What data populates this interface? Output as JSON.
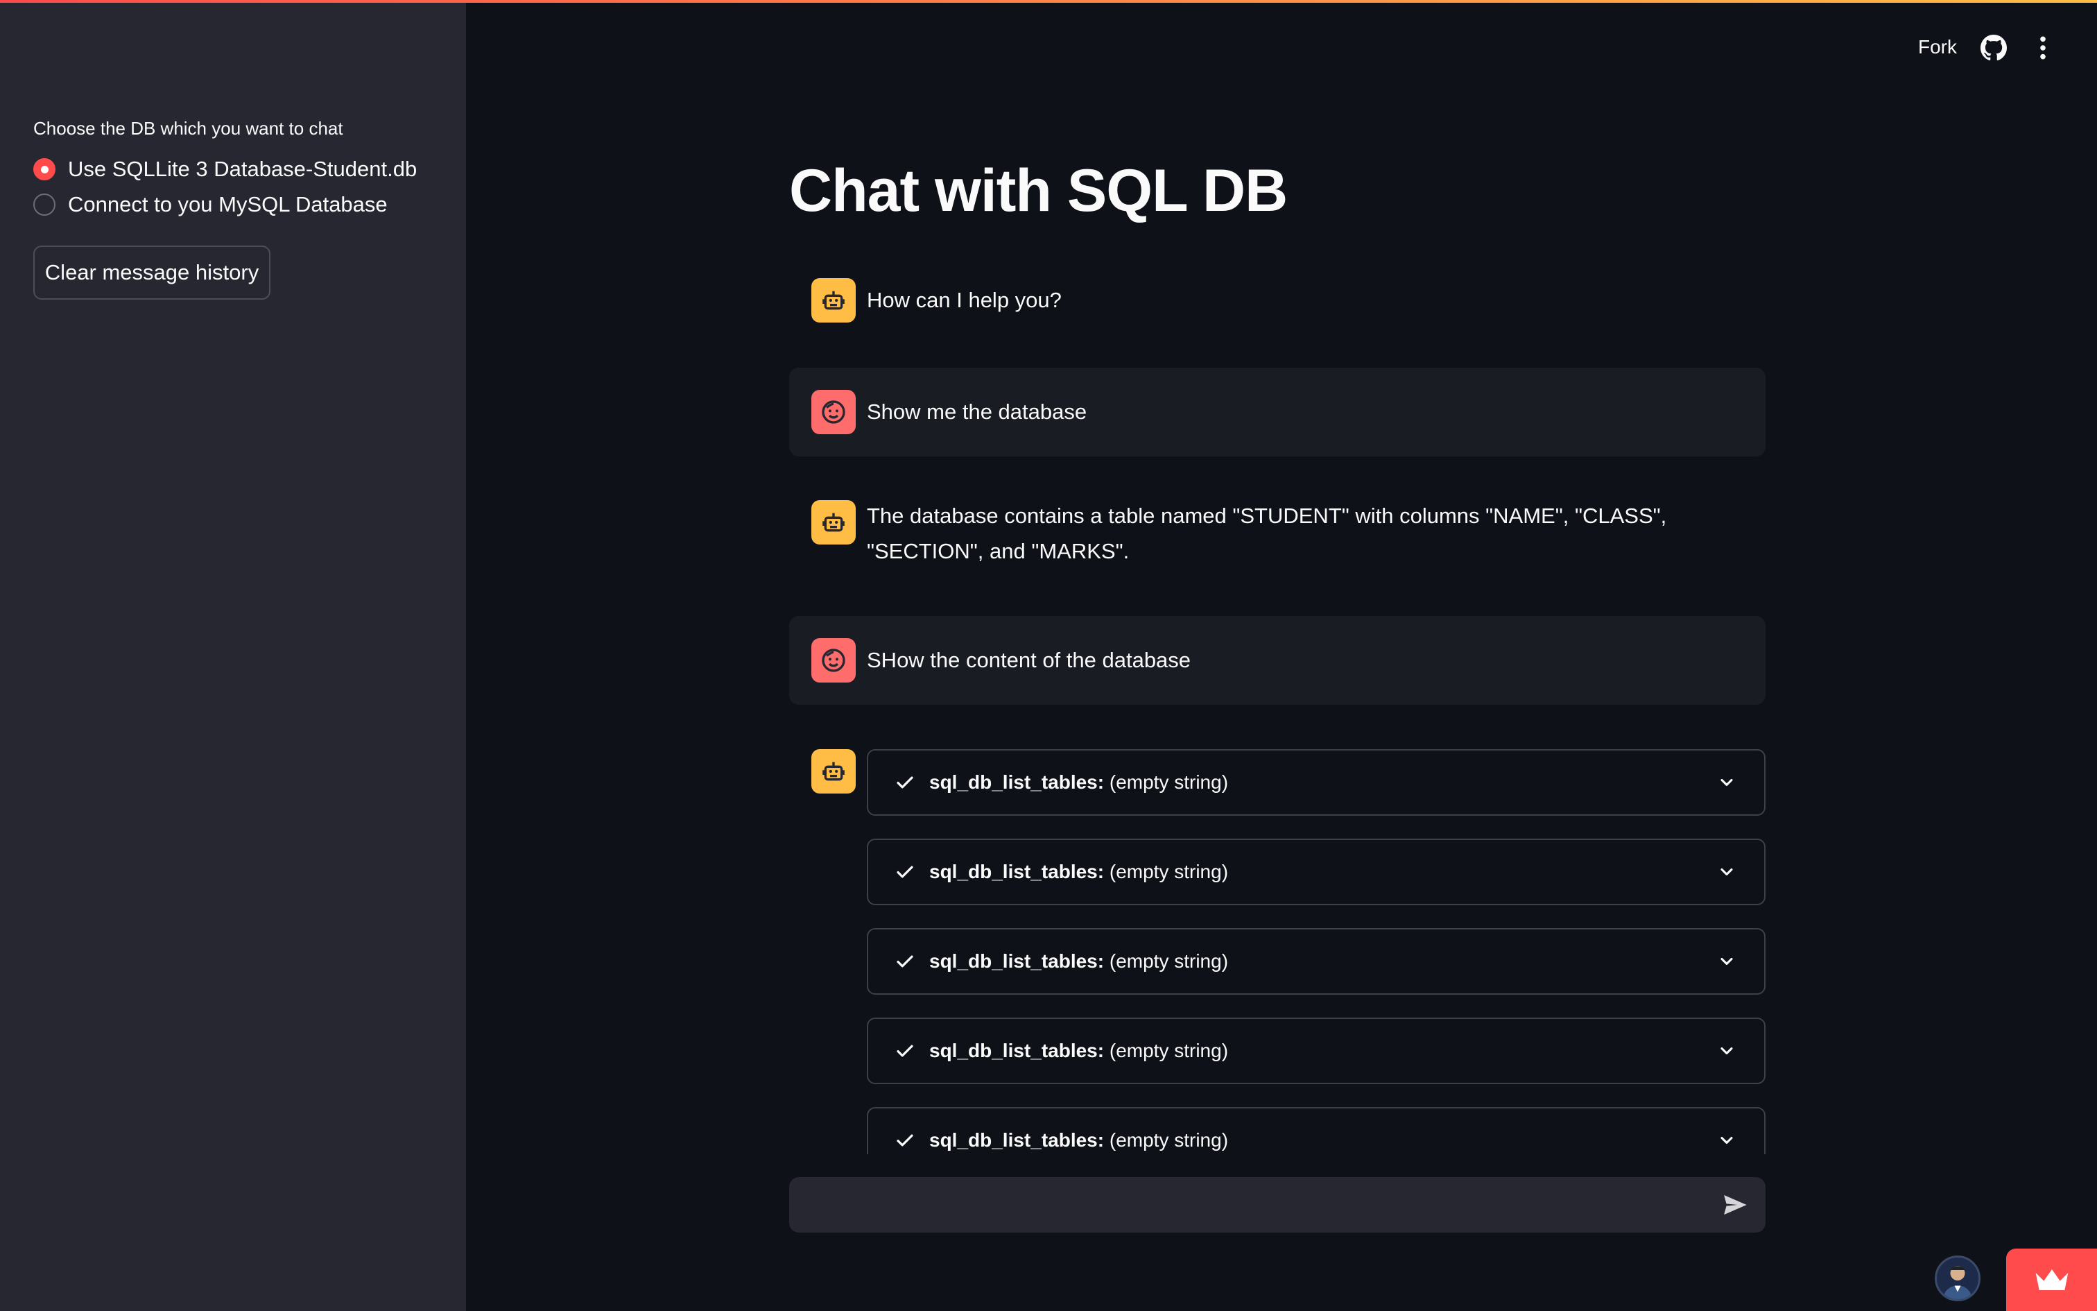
{
  "sidebar": {
    "db_label": "Choose the DB which you want to chat",
    "options": [
      {
        "label": "Use SQLLite 3 Database-Student.db",
        "selected": true
      },
      {
        "label": "Connect to you MySQL Database",
        "selected": false
      }
    ],
    "clear_button": "Clear message history"
  },
  "header": {
    "fork": "Fork"
  },
  "main": {
    "title": "Chat with SQL DB",
    "messages": [
      {
        "role": "assistant",
        "text": "How can I help you?"
      },
      {
        "role": "user",
        "text": "Show me the database"
      },
      {
        "role": "assistant",
        "text": "The database contains a table named \"STUDENT\" with columns \"NAME\", \"CLASS\", \"SECTION\", and \"MARKS\"."
      },
      {
        "role": "user",
        "text": "SHow the content of the database"
      }
    ],
    "tool_calls": [
      {
        "name": "sql_db_list_tables:",
        "arg": "(empty string)"
      },
      {
        "name": "sql_db_list_tables:",
        "arg": "(empty string)"
      },
      {
        "name": "sql_db_list_tables:",
        "arg": "(empty string)"
      },
      {
        "name": "sql_db_list_tables:",
        "arg": "(empty string)"
      },
      {
        "name": "sql_db_list_tables:",
        "arg": "(empty string)"
      }
    ]
  },
  "chat_input": {
    "placeholder": "",
    "value": ""
  },
  "colors": {
    "background": "#0e1117",
    "sidebar": "#262730",
    "accent": "#ff4b4b",
    "assistant_avatar": "#ffbd45",
    "user_avatar": "#ff6c6c"
  },
  "icons": {
    "assistant_avatar": "robot-icon",
    "user_avatar": "smiley-face-icon",
    "github": "github-icon",
    "menu": "more-vertical-icon",
    "send": "send-icon",
    "tool_status": "check-icon",
    "expand": "chevron-down-icon",
    "deploy": "crown-icon"
  }
}
